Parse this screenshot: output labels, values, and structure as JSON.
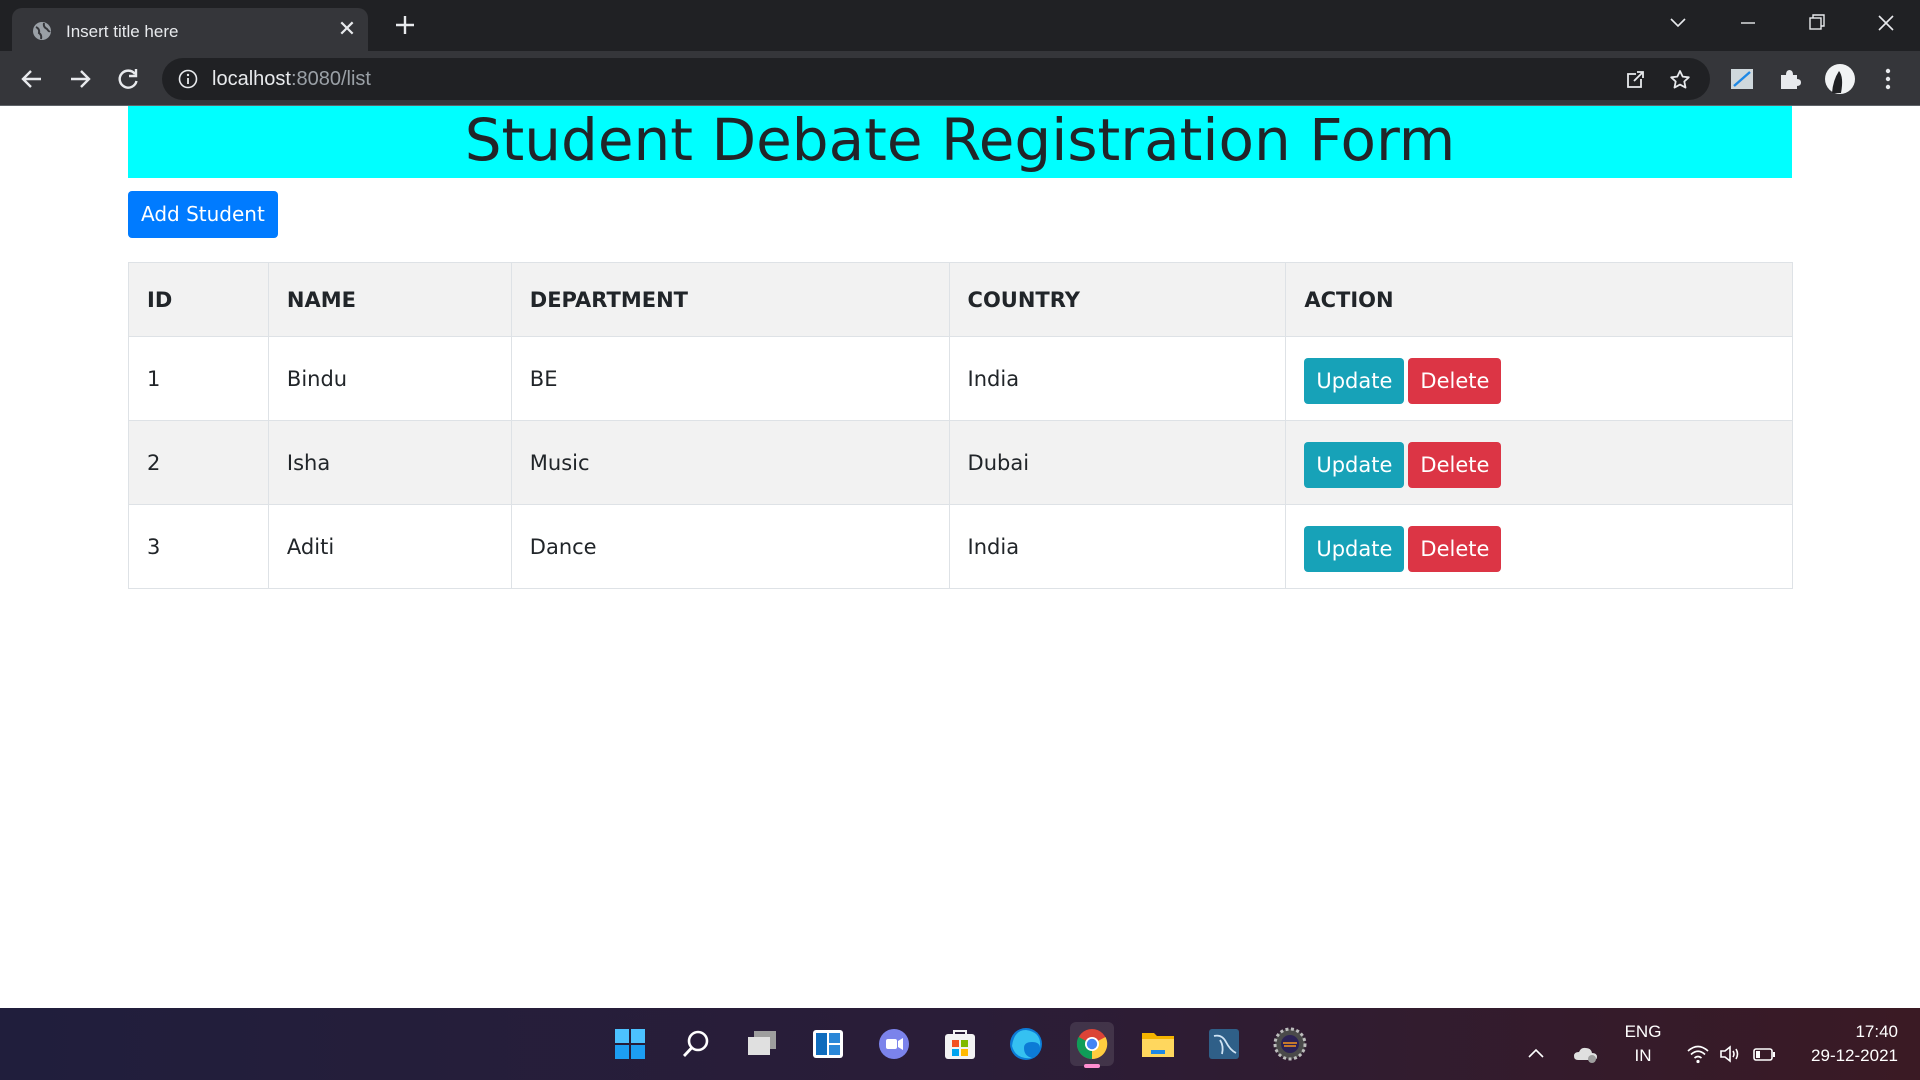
{
  "browser": {
    "tab_title": "Insert title here",
    "url_host": "localhost",
    "url_rest": ":8080/list"
  },
  "page": {
    "heading": "Student Debate Registration Form",
    "add_button": "Add Student",
    "banner_color": "#00ffff",
    "table": {
      "headers": [
        "ID",
        "NAME",
        "DEPARTMENT",
        "COUNTRY",
        "ACTION"
      ],
      "rows": [
        {
          "id": "1",
          "name": "Bindu",
          "department": "BE",
          "country": "India"
        },
        {
          "id": "2",
          "name": "Isha",
          "department": "Music",
          "country": "Dubai"
        },
        {
          "id": "3",
          "name": "Aditi",
          "department": "Dance",
          "country": "India"
        }
      ],
      "update_label": "Update",
      "delete_label": "Delete"
    }
  },
  "taskbar": {
    "apps": [
      "start-icon",
      "search-icon",
      "task-view-icon",
      "widgets-icon",
      "teams-chat-icon",
      "microsoft-store-icon",
      "edge-icon",
      "chrome-icon",
      "file-explorer-icon",
      "mysql-workbench-icon",
      "eclipse-ide-icon"
    ],
    "lang_top": "ENG",
    "lang_bottom": "IN",
    "time": "17:40",
    "date": "29-12-2021"
  }
}
